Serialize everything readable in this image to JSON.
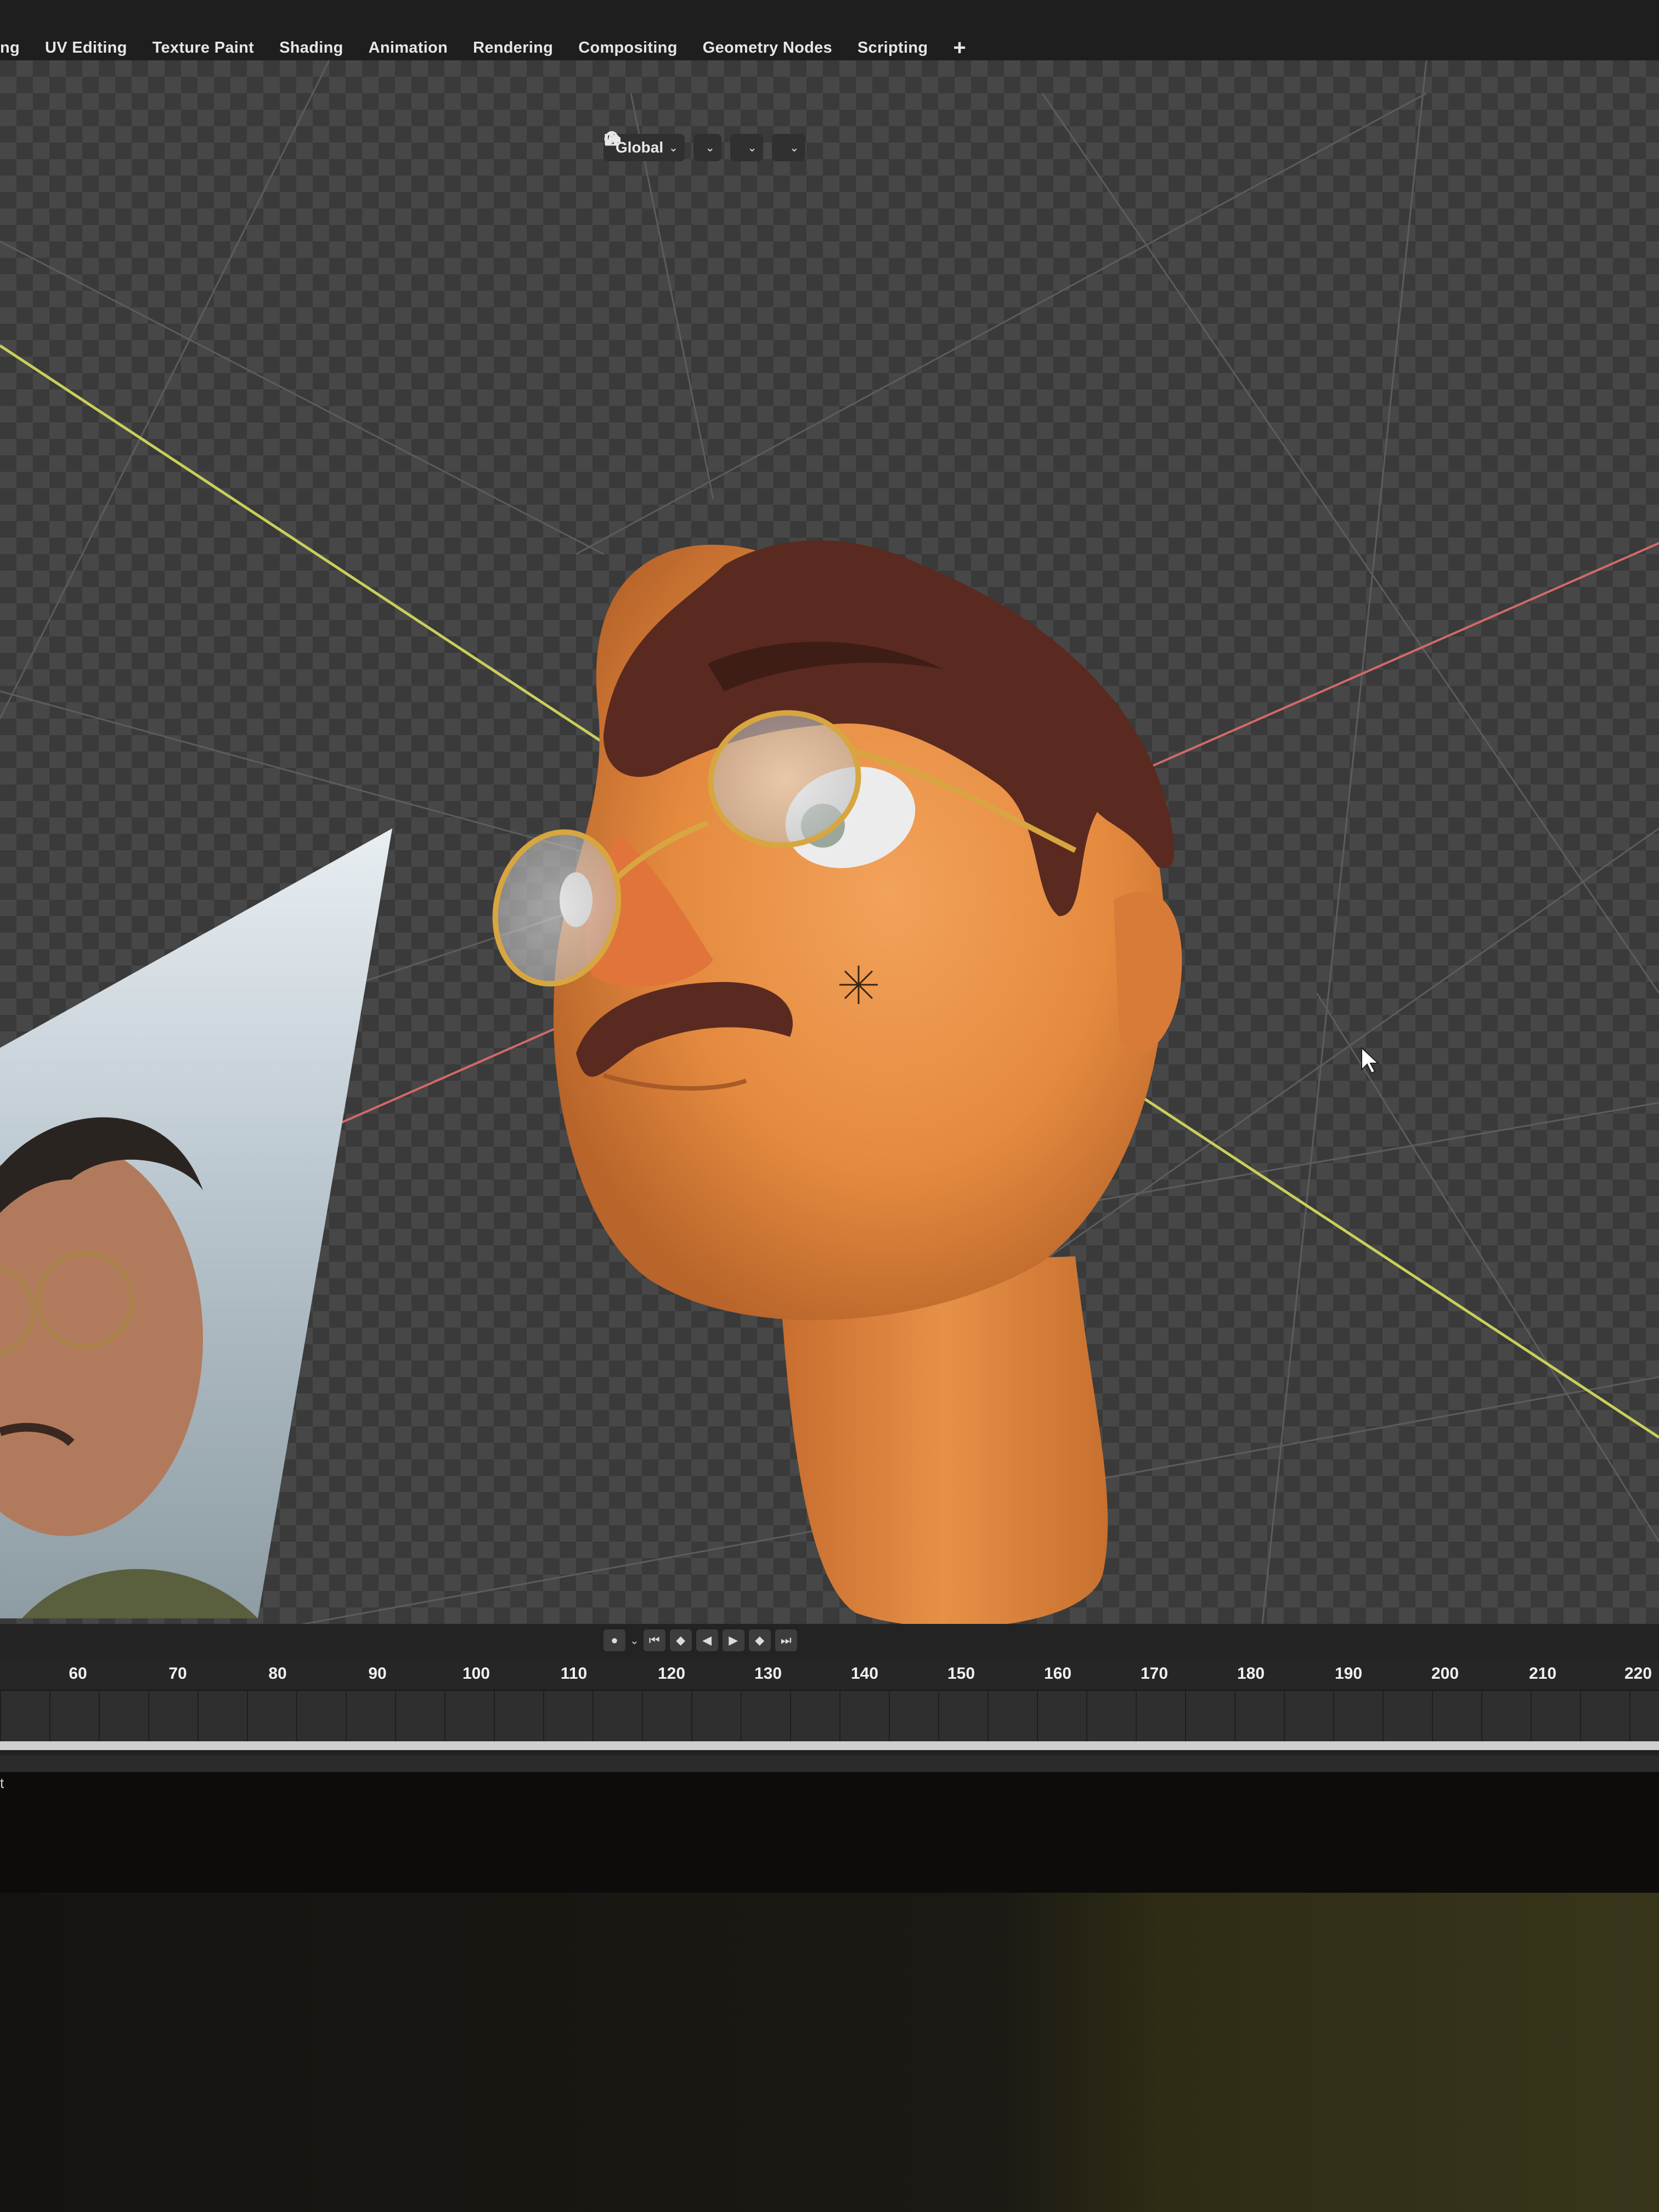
{
  "workspace_tabs": [
    "ng",
    "UV Editing",
    "Texture Paint",
    "Shading",
    "Animation",
    "Rendering",
    "Compositing",
    "Geometry Nodes",
    "Scripting"
  ],
  "workspace_add_label": "+",
  "header": {
    "transform_orientation": "Global",
    "icons": [
      "transform-orientation-icon",
      "pivot-point-icon",
      "snap-icon",
      "snap-target-icon",
      "proportional-editing-icon",
      "falloff-curve-icon"
    ]
  },
  "timeline": {
    "frame_labels": [
      "60",
      "70",
      "80",
      "90",
      "100",
      "110",
      "120",
      "130",
      "140",
      "150",
      "160",
      "170",
      "180",
      "190",
      "200",
      "210",
      "220"
    ],
    "playback_icons": [
      "record-icon",
      "jump-start-icon",
      "prev-keyframe-icon",
      "play-reverse-icon",
      "play-icon",
      "next-keyframe-icon",
      "jump-end-icon"
    ]
  },
  "status_bar_text": "t",
  "colors": {
    "x_axis": "#d36a6a",
    "y_axis": "#c9cf5a",
    "skin": "#e48a3f",
    "hair": "#5a2a20",
    "glasses_frame": "#d8a640"
  }
}
